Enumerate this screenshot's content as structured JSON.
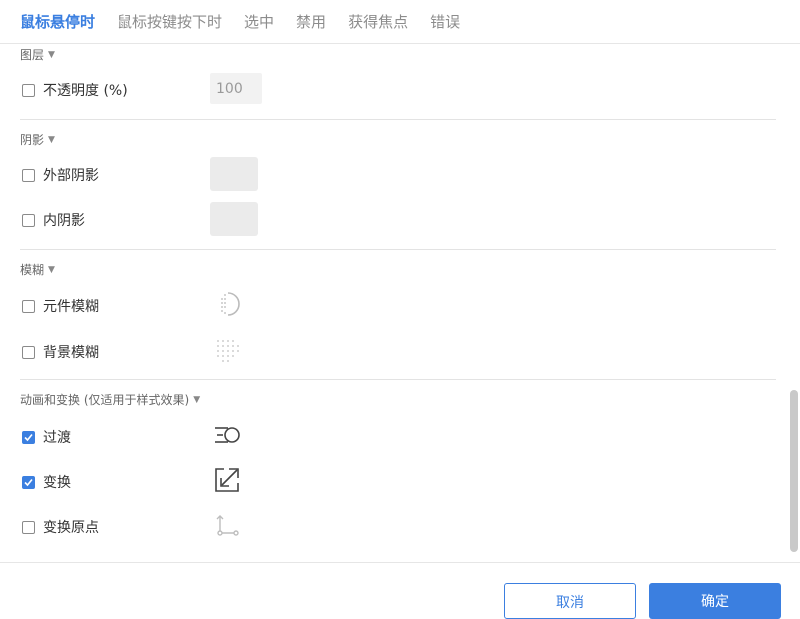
{
  "tabs": [
    {
      "label": "鼠标悬停时",
      "active": true
    },
    {
      "label": "鼠标按键按下时"
    },
    {
      "label": "选中"
    },
    {
      "label": "禁用"
    },
    {
      "label": "获得焦点"
    },
    {
      "label": "错误"
    }
  ],
  "layer": {
    "title": "图层",
    "opacity": {
      "label": "不透明度 (%)",
      "checked": false,
      "value": "100"
    }
  },
  "shadow": {
    "title": "阴影",
    "outer": {
      "label": "外部阴影",
      "checked": false
    },
    "inner": {
      "label": "内阴影",
      "checked": false
    }
  },
  "blur": {
    "title": "模糊",
    "element": {
      "label": "元件模糊",
      "checked": false,
      "icon": "element-blur-icon"
    },
    "background": {
      "label": "背景模糊",
      "checked": false,
      "icon": "background-blur-icon"
    }
  },
  "animation": {
    "title": "动画和变换 (仅适用于样式效果)",
    "transition": {
      "label": "过渡",
      "checked": true,
      "icon": "transition-icon"
    },
    "transform": {
      "label": "变换",
      "checked": true,
      "icon": "transform-icon"
    },
    "origin": {
      "label": "变换原点",
      "checked": false,
      "icon": "transform-origin-icon"
    }
  },
  "footer": {
    "cancel_label": "取消",
    "ok_label": "确定"
  },
  "colors": {
    "accent": "#3b7fe0"
  }
}
